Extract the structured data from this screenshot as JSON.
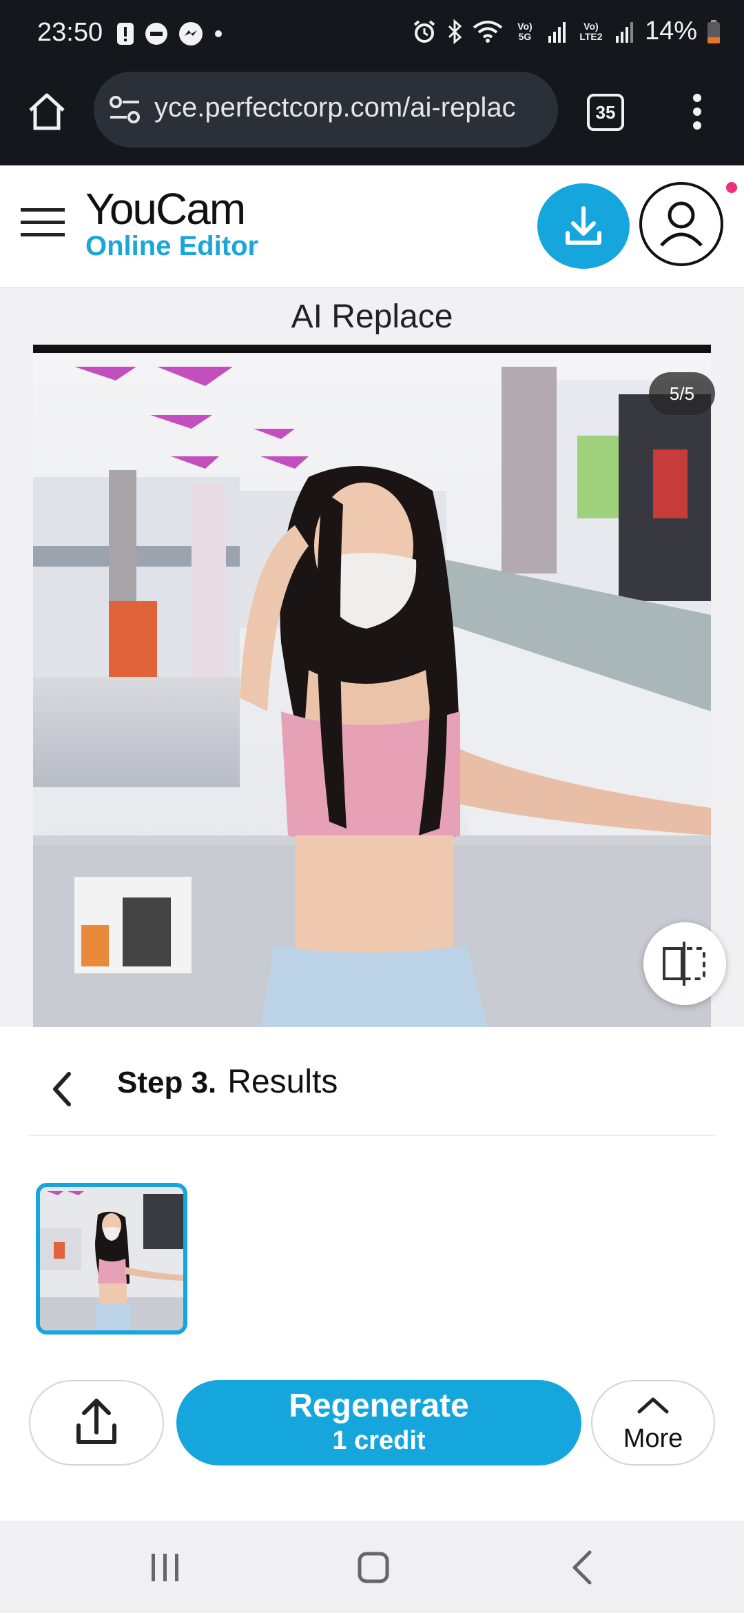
{
  "status_bar": {
    "time": "23:50",
    "battery": "14%",
    "network1": "Vo) 5G",
    "network2": "Vo) LTE2",
    "icons": [
      "alert-icon",
      "dnd-icon",
      "messenger-icon",
      "dot-icon",
      "alarm-icon",
      "bluetooth-icon",
      "wifi-icon",
      "signal-icon",
      "battery-icon"
    ]
  },
  "browser": {
    "url": "yce.perfectcorp.com/ai-replac",
    "tab_count": "35",
    "icons": [
      "home-icon",
      "site-settings-icon",
      "kebab-menu-icon"
    ]
  },
  "header": {
    "brand_main": "YouCam",
    "brand_sub": "Online Editor",
    "colors": {
      "accent": "#14a6dc",
      "brand_sub": "#1aa6d8",
      "notify": "#ee2f7c"
    }
  },
  "page": {
    "title": "AI Replace",
    "counter": "5/5"
  },
  "results": {
    "step_label": "Step 3.",
    "step_title": "Results",
    "thumbnails": 1
  },
  "actions": {
    "regenerate_label": "Regenerate",
    "regenerate_cost": "1 credit",
    "more_label": "More"
  },
  "navbar": {
    "icons": [
      "recents-icon",
      "home-nav-icon",
      "back-nav-icon"
    ]
  }
}
